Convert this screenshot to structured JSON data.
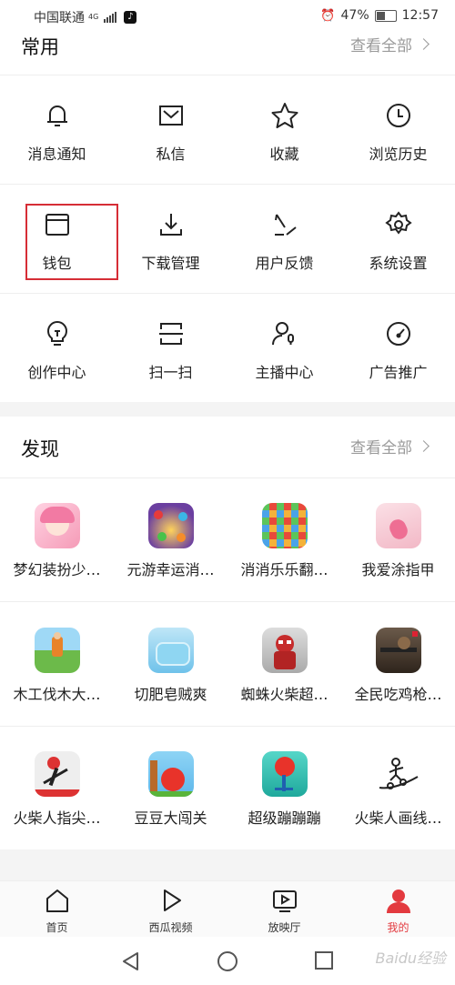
{
  "status": {
    "carrier": "中国联通",
    "network": "4G",
    "battery": "47%",
    "time": "12:57"
  },
  "common": {
    "title": "常用",
    "see_all": "查看全部",
    "items": [
      {
        "label": "消息通知",
        "icon": "bell-icon"
      },
      {
        "label": "私信",
        "icon": "mail-icon"
      },
      {
        "label": "收藏",
        "icon": "star-icon"
      },
      {
        "label": "浏览历史",
        "icon": "clock-icon"
      },
      {
        "label": "钱包",
        "icon": "wallet-icon"
      },
      {
        "label": "下载管理",
        "icon": "download-icon"
      },
      {
        "label": "用户反馈",
        "icon": "feedback-pen-icon"
      },
      {
        "label": "系统设置",
        "icon": "gear-icon"
      },
      {
        "label": "创作中心",
        "icon": "lightbulb-icon"
      },
      {
        "label": "扫一扫",
        "icon": "scan-icon"
      },
      {
        "label": "主播中心",
        "icon": "streamer-icon"
      },
      {
        "label": "广告推广",
        "icon": "gauge-icon"
      }
    ]
  },
  "discover": {
    "title": "发现",
    "see_all": "查看全部",
    "apps": [
      {
        "label": "梦幻装扮少…",
        "color": "#f7b3c8"
      },
      {
        "label": "元游幸运消…",
        "color": "#6b3fa0"
      },
      {
        "label": "消消乐乐翻…",
        "color": "#e86b3a"
      },
      {
        "label": "我爱涂指甲",
        "color": "#f4c6cf"
      },
      {
        "label": "木工伐木大…",
        "color": "#7cc35a"
      },
      {
        "label": "切肥皂贼爽",
        "color": "#7fc8e8"
      },
      {
        "label": "蜘蛛火柴超…",
        "color": "#c62c2c"
      },
      {
        "label": "全民吃鸡枪…",
        "color": "#5a4a3a"
      },
      {
        "label": "火柴人指尖…",
        "color": "#e8e8e8"
      },
      {
        "label": "豆豆大闯关",
        "color": "#7cc7ef"
      },
      {
        "label": "超级蹦蹦蹦",
        "color": "#33c6b8"
      },
      {
        "label": "火柴人画线…",
        "color": "#ffffff"
      }
    ]
  },
  "nav": {
    "items": [
      {
        "label": "首页"
      },
      {
        "label": "西瓜视频"
      },
      {
        "label": "放映厅"
      },
      {
        "label": "我的"
      }
    ],
    "accent": "#e33a3f"
  },
  "watermark": "Baidu经验"
}
